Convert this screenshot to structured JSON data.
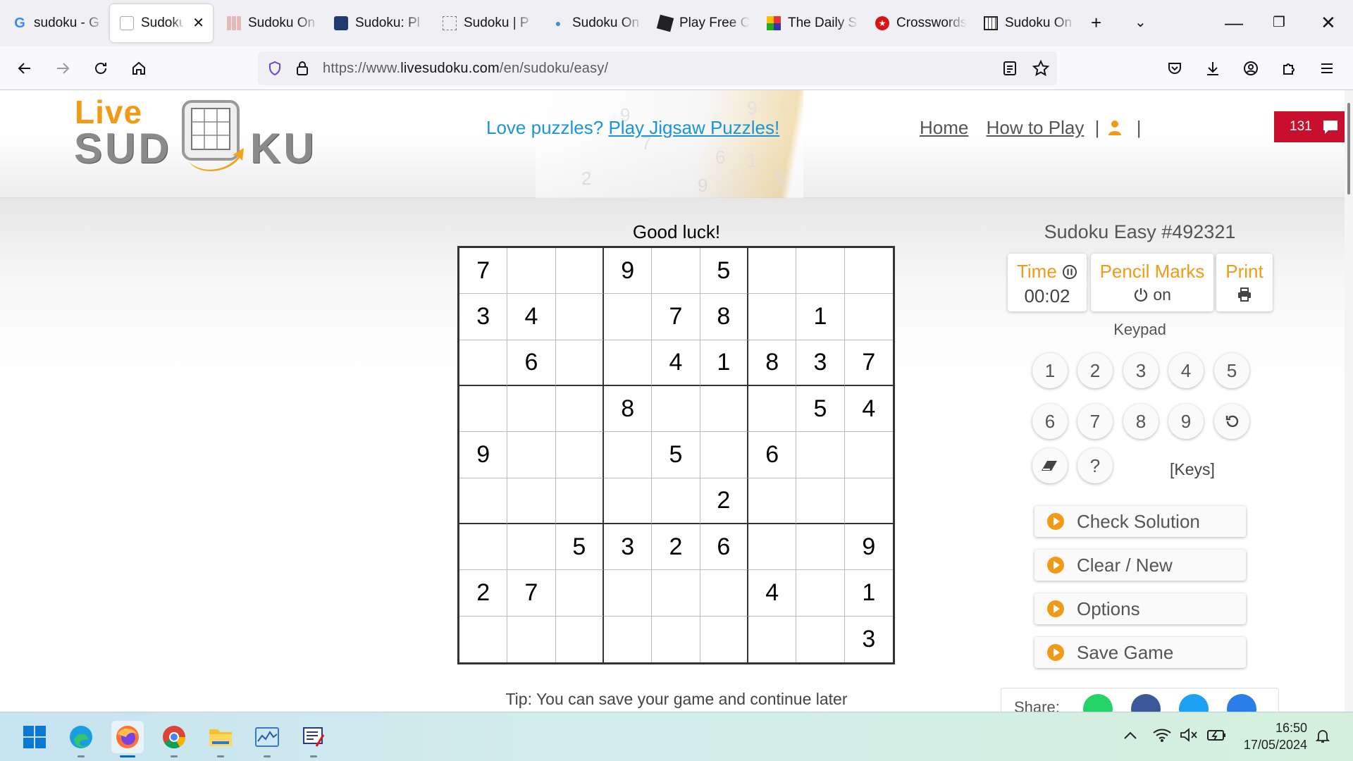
{
  "browser": {
    "tabs": [
      {
        "label": "sudoku - G",
        "icon": "google-icon"
      },
      {
        "label": "Sudoku |",
        "icon": "livesudoku-icon",
        "active": true
      },
      {
        "label": "Sudoku On",
        "icon": "grid-icon"
      },
      {
        "label": "Sudoku: Pl",
        "icon": "sudoku-shield-icon"
      },
      {
        "label": "Sudoku | P",
        "icon": "dotted-grid-icon"
      },
      {
        "label": "Sudoku On",
        "icon": "bulb-icon"
      },
      {
        "label": "Play Free C",
        "icon": "puzzle-icon"
      },
      {
        "label": "The Daily S",
        "icon": "color-grid-icon"
      },
      {
        "label": "Crosswords",
        "icon": "red-star-icon"
      },
      {
        "label": "Sudoku On",
        "icon": "dark-grid-icon"
      }
    ],
    "url_prefix": "https://www.",
    "url_domain": "livesudoku.com",
    "url_path": "/en/sudoku/easy/"
  },
  "site": {
    "logo_live": "Live",
    "logo_sud": "SUD",
    "logo_ku": "KU",
    "promo_text": "Love puzzles?",
    "promo_link": "Play Jigsaw Puzzles!",
    "nav_home": "Home",
    "nav_howto": "How to Play",
    "nav_sep": "|",
    "message_count": "131"
  },
  "game": {
    "status": "Good luck!",
    "title": "Sudoku Easy #492321",
    "time_label": "Time",
    "time_value": "00:02",
    "pencil_label": "Pencil Marks",
    "pencil_value": "on",
    "print_label": "Print",
    "keypad_label": "Keypad",
    "keys_link": "[Keys]",
    "tip": "Tip: You can save your game and continue later",
    "share_label": "Share:",
    "grid": [
      [
        "7",
        "",
        "",
        "9",
        "",
        "5",
        "",
        "",
        ""
      ],
      [
        "3",
        "4",
        "",
        "",
        "7",
        "8",
        "",
        "1",
        ""
      ],
      [
        "",
        "6",
        "",
        "",
        "4",
        "1",
        "8",
        "3",
        "7"
      ],
      [
        "",
        "",
        "",
        "8",
        "",
        "",
        "",
        "5",
        "4"
      ],
      [
        "9",
        "",
        "",
        "",
        "5",
        "",
        "6",
        "",
        ""
      ],
      [
        "",
        "",
        "",
        "",
        "",
        "2",
        "",
        "",
        ""
      ],
      [
        "",
        "",
        "5",
        "3",
        "2",
        "6",
        "",
        "",
        "9"
      ],
      [
        "2",
        "7",
        "",
        "",
        "",
        "",
        "4",
        "",
        "1"
      ],
      [
        "",
        "",
        "",
        "",
        "",
        "",
        "",
        "",
        "3"
      ]
    ],
    "keypad": [
      "1",
      "2",
      "3",
      "4",
      "5",
      "6",
      "7",
      "8",
      "9"
    ],
    "actions": [
      "Check Solution",
      "Clear / New",
      "Options",
      "Save Game"
    ]
  },
  "taskbar": {
    "apps": [
      "windows-start-icon",
      "edge-icon",
      "firefox-icon",
      "chrome-icon",
      "file-explorer-icon",
      "task-manager-icon",
      "snipping-tool-icon"
    ],
    "time": "16:50",
    "date": "17/05/2024"
  },
  "colors": {
    "accent_orange": "#f29a16",
    "link_blue": "#1a96d6",
    "badge_red": "#c8102e"
  }
}
